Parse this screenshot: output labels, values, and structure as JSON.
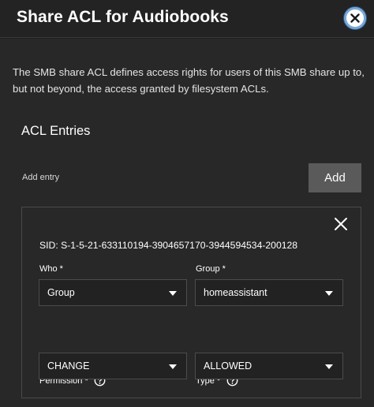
{
  "dialog": {
    "title": "Share ACL for Audiobooks",
    "description": "The SMB share ACL defines access rights for users of this SMB share up to, but not beyond, the access granted by filesystem ACLs."
  },
  "acl": {
    "section_title": "ACL Entries",
    "add_entry_label": "Add entry",
    "add_button": "Add",
    "entry": {
      "sid": "SID: S-1-5-21-633110194-3904657170-3944594534-200128",
      "who_label": "Who *",
      "who_value": "Group",
      "group_label": "Group *",
      "group_value": "homeassistant",
      "permission_label": "Permission *",
      "permission_value": "CHANGE",
      "type_label": "Type *",
      "type_value": "ALLOWED"
    }
  },
  "icons": [
    "close-icon",
    "help-icon",
    "chevron-down-icon"
  ],
  "colors": {
    "header_bg": "#232323",
    "body_bg": "#282828",
    "button_bg": "#5a5a5a",
    "focus_ring": "#7aa7d6"
  }
}
